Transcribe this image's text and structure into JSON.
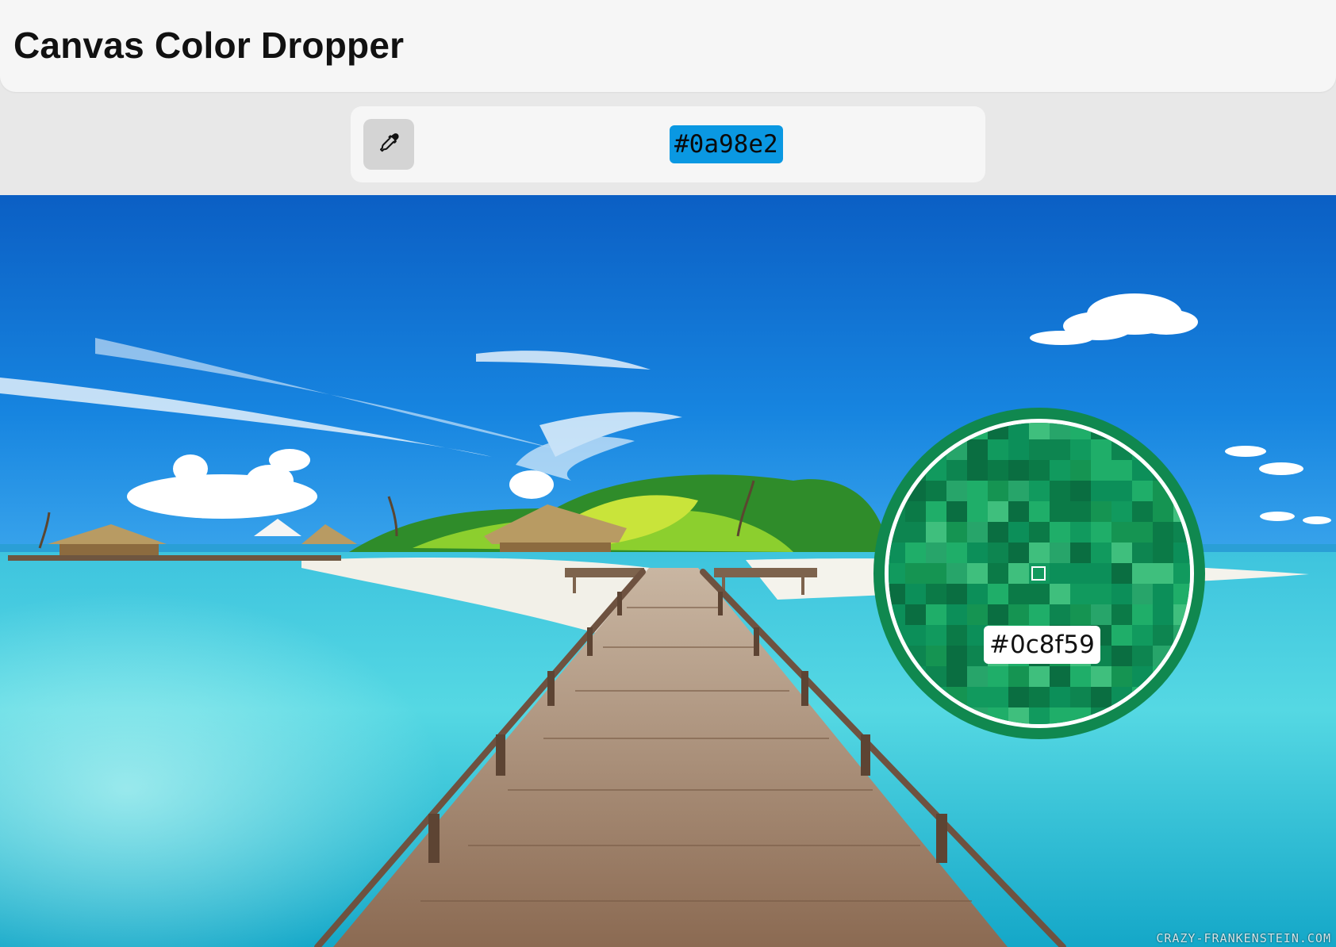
{
  "app": {
    "title": "Canvas Color Dropper"
  },
  "toolbar": {
    "picker_icon": "eyedropper-icon",
    "selected_color": {
      "hex": "#0a98e2",
      "swatch": "#0a98e2"
    }
  },
  "magnifier": {
    "sample_hex": "#0c8f59",
    "ring_color": "#10884f",
    "pixel_palette": [
      "#0c8f59",
      "#119a5e",
      "#0b7a47",
      "#1fae69",
      "#0a6e41",
      "#27a56a",
      "#159452",
      "#3fbf7d",
      "#0d8550"
    ]
  },
  "canvas": {
    "image_subject": "tropical-beach-pier",
    "watermark": "CRAZY-FRANKENSTEIN.COM"
  },
  "palette": {
    "sky_top": "#0b63c9",
    "sky_mid": "#1a8be6",
    "water_light": "#4fd7e2",
    "water_deep": "#12a9c9",
    "sand": "#f2f0e8",
    "pier": "#9a7a60",
    "foliage": "#3a9b2c"
  }
}
